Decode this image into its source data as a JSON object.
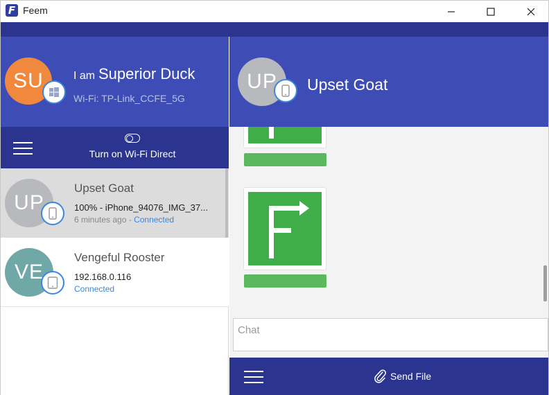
{
  "window": {
    "title": "Feem",
    "logo_letter": "F"
  },
  "me": {
    "initials": "SU",
    "prefix": "I am",
    "name": "Superior Duck",
    "wifi": "Wi-Fi: TP-Link_CCFE_5G",
    "avatar_color": "#f0883d",
    "platform_icon": "windows-icon"
  },
  "left_toolbar": {
    "wifi_direct_label": "Turn on Wi-Fi Direct"
  },
  "peers": [
    {
      "initials": "UP",
      "name": "Upset Goat",
      "detail": "100% - iPhone_94076_IMG_37...",
      "time": "6 minutes ago",
      "separator": " - ",
      "status": "Connected",
      "avatar_color": "#b7b9bd",
      "device_icon": "phone-icon",
      "selected": true
    },
    {
      "initials": "VE",
      "name": "Vengeful Rooster",
      "detail": "192.168.0.116",
      "status": "Connected",
      "avatar_color": "#6fa8a7",
      "device_icon": "tablet-icon",
      "selected": false
    }
  ],
  "conversation": {
    "initials": "UP",
    "name": "Upset Goat",
    "chat_placeholder": "Chat",
    "chat_value": "",
    "send_file_label": "Send File",
    "file_items": [
      {
        "progress": 1.0
      },
      {
        "progress": 1.0
      }
    ]
  },
  "colors": {
    "header_blue": "#3d4db5",
    "toolbar_blue": "#2b3590",
    "accent": "#3b86e0",
    "file_green": "#3fae49",
    "progress_green": "#5cb85c"
  }
}
